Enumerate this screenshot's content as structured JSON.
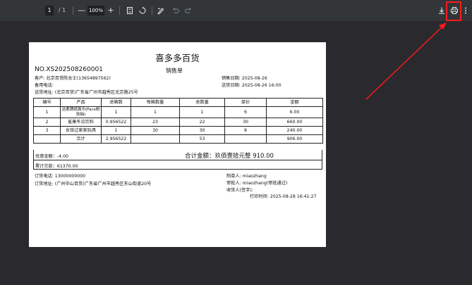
{
  "toolbar": {
    "current_page": "1",
    "page_total": "/ 1",
    "zoom_out": "—",
    "zoom_level": "100%",
    "zoom_in": "+",
    "icons": [
      "fit-page-icon",
      "rotate-icon",
      "annotate-icon",
      "undo-icon",
      "redo-icon",
      "download-icon",
      "print-icon",
      "more-icon"
    ]
  },
  "doc": {
    "store_name": "喜多多百货",
    "order_no": "NO.XS202508260001",
    "doc_type": "销售单",
    "customer": "客户: 北京百货陈女士(13654897562)",
    "backup_phone": "备用电话:",
    "ship_address": "送货地址: (北京百货)广东省广州市越秀区北京路25号",
    "sale_date": "销售日期: 2025-08-26",
    "delivery_date": "送货日期: 2025-08-26 16:00",
    "table": {
      "headers": [
        "编号",
        "产品",
        "总箱数",
        "每箱数量",
        "总数量",
        "单价",
        "金额"
      ],
      "rows": [
        [
          "1",
          "洁柔牌纸面巾(Face粉软抽)",
          "1",
          "1",
          "1",
          "6",
          "6.00"
        ],
        [
          "2",
          "雀巢冬瓜饮料",
          "0.956522",
          "23",
          "22",
          "30",
          "660.00"
        ],
        [
          "3",
          "女孩过家家玩具",
          "1",
          "30",
          "30",
          "8",
          "240.00"
        ]
      ],
      "total_row": [
        "",
        "合计",
        "2.956522",
        "",
        "53",
        "",
        "906.00"
      ]
    },
    "discount": "优惠金额：-4.00",
    "total_amount": "合计金额：玖佰壹拾元整 910.00",
    "accumulated_debt": "累计欠款：61370.00",
    "order_phone": "订货电话: 13000000000",
    "order_address": "订货地址: (广州中山百货)广东省广州市越秀区东山街道20号",
    "maker": "制单人: miaozhang",
    "approver": "审批人: miaozhang(审批通过)",
    "receiver": "收货人(签字):",
    "print_time": "打印时间: 2025-08-28 16:41:27"
  },
  "colors": {
    "viewer_bg": "#2a2a2e",
    "toolbar_bg": "#323639",
    "highlight": "#ff1a1a"
  }
}
